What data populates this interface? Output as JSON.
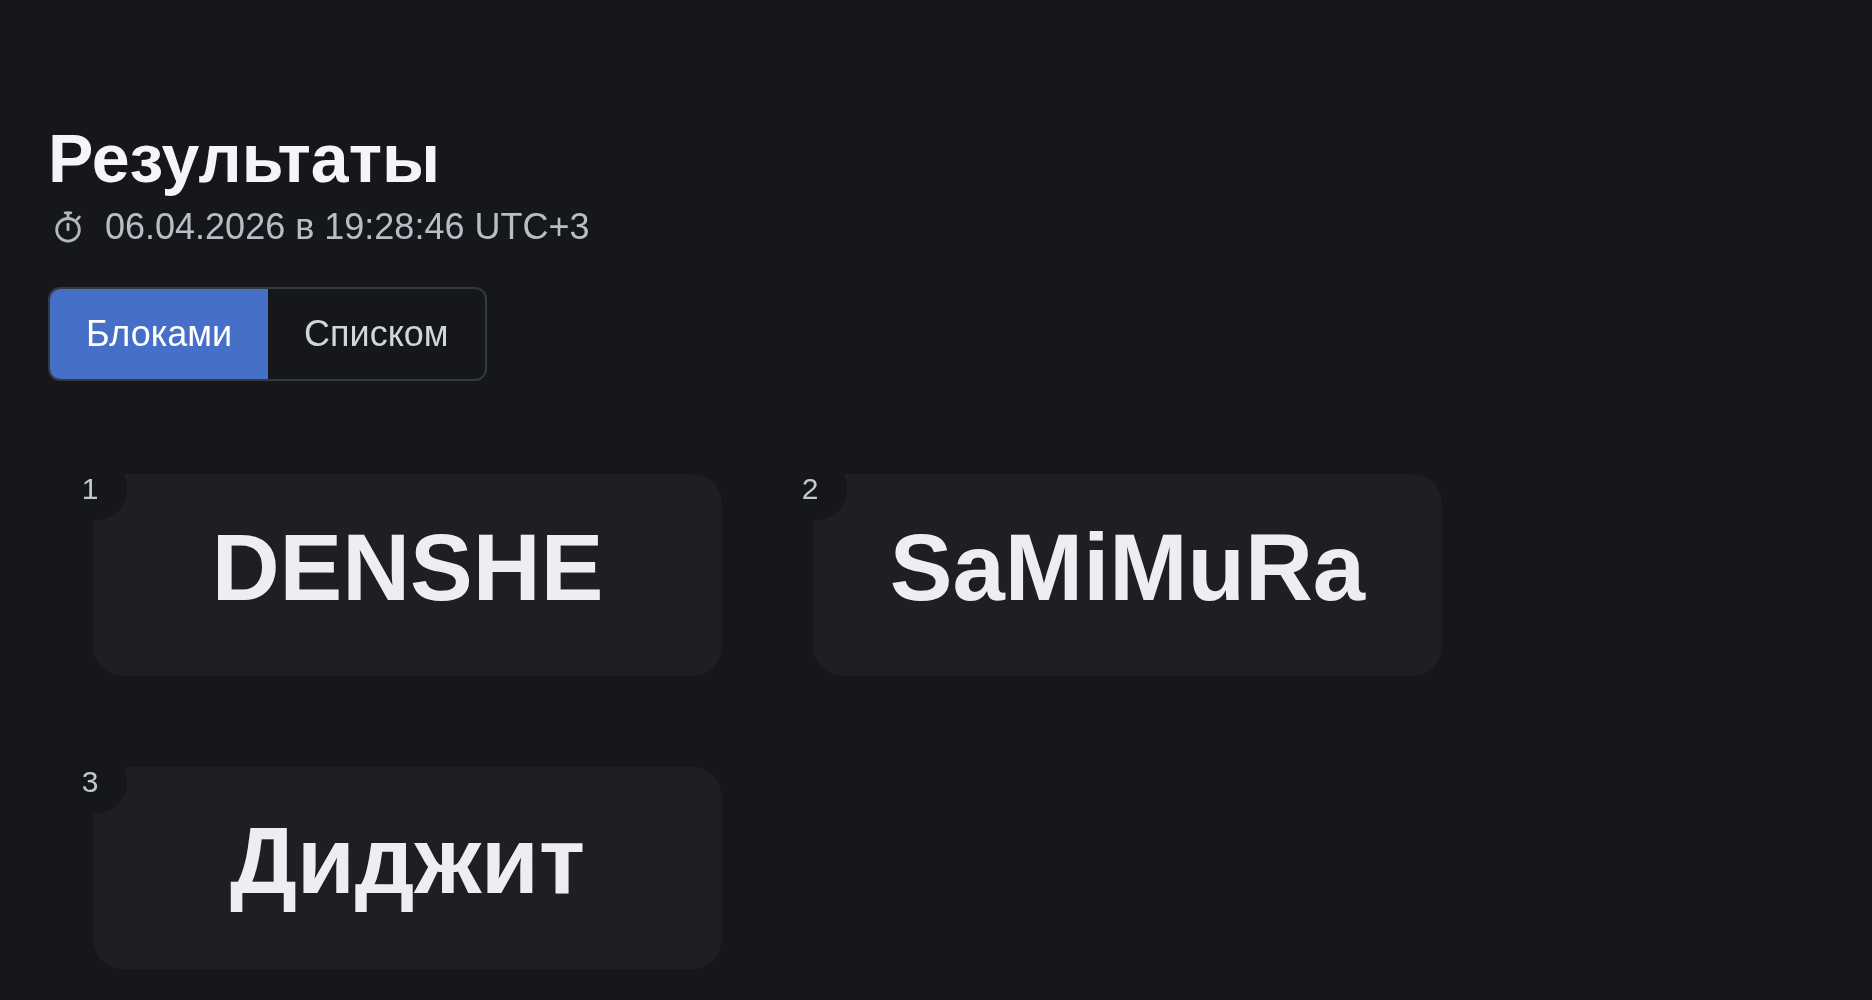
{
  "title": "Результаты",
  "timestamp": "06.04.2026 в 19:28:46 UTC+3",
  "view_tabs": [
    {
      "label": "Блоками",
      "selected": true
    },
    {
      "label": "Списком",
      "selected": false
    }
  ],
  "results": [
    {
      "place": "1",
      "name": "DENSHE"
    },
    {
      "place": "2",
      "name": "SaMiMuRa"
    },
    {
      "place": "3",
      "name": "Диджит"
    }
  ]
}
